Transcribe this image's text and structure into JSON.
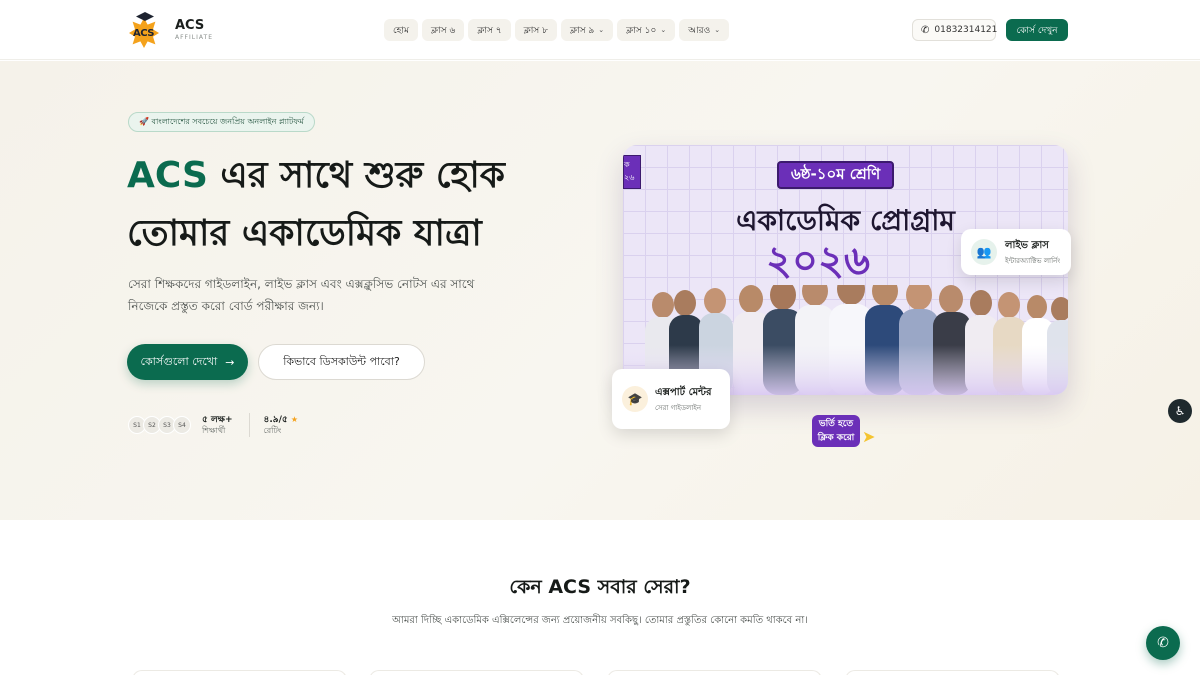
{
  "header": {
    "logo_title": "ACS",
    "logo_subtitle": "AFFILIATE",
    "logo_mark_text": "ACS",
    "nav": [
      {
        "label": "হোম",
        "has_dropdown": false
      },
      {
        "label": "ক্লাস ৬",
        "has_dropdown": false
      },
      {
        "label": "ক্লাস ৭",
        "has_dropdown": false
      },
      {
        "label": "ক্লাস ৮",
        "has_dropdown": false
      },
      {
        "label": "ক্লাস ৯",
        "has_dropdown": true
      },
      {
        "label": "ক্লাস ১০",
        "has_dropdown": true
      },
      {
        "label": "আরও",
        "has_dropdown": true
      }
    ],
    "phone": "01832314121",
    "cta_label": "কোর্স দেখুন"
  },
  "hero": {
    "badge": "🚀 বাংলাদেশের সবচেয়ে জনপ্রিয় অনলাইন প্ল্যাটফর্ম",
    "title_brand": "ACS",
    "title_rest_line1": " এর সাথে শুরু হোক",
    "title_line2": "তোমার একাডেমিক যাত্রা",
    "subtext": "সেরা শিক্ষকদের গাইডলাইন, লাইভ ক্লাস এবং এক্সক্লুসিভ নোটস এর সাথে নিজেকে প্রস্তুত করো বোর্ড পরীক্ষার জন্য।",
    "primary_button": "কোর্সগুলো দেখো",
    "secondary_button": "কিভাবে ডিসকাউন্ট পাবো?",
    "avatars": [
      "S1",
      "S2",
      "S3",
      "S4"
    ],
    "stat_students_value": "৫ লক্ষ+",
    "stat_students_label": "শিক্ষার্থী",
    "stat_rating_value": "৪.৯/৫",
    "stat_rating_label": "রেটিং"
  },
  "banner": {
    "tag": "৬ষ্ঠ-১০ম শ্রেণি",
    "title": "একাডেমিক প্রোগ্রাম",
    "year": "২০২৬",
    "left_strip": "ক ২৬",
    "enroll_tag": "ভর্তি হতে ক্লিক করো"
  },
  "floating": {
    "live_title": "লাইভ ক্লাস",
    "live_sub": "ইন্টারঅ্যাক্টিভ লার্নিং",
    "mentor_title": "এক্সপার্ট মেন্টর",
    "mentor_sub": "সেরা গাইডলাইন"
  },
  "section": {
    "title": "কেন ACS সবার সেরা?",
    "subtitle": "আমরা দিচ্ছি একাডেমিক এক্সিলেন্সের জন্য প্রয়োজনীয় সবকিছু। তোমার প্রস্তুতির কোনো কমতি থাকবে না।"
  },
  "colors": {
    "brand_green": "#0b6b4f",
    "banner_purple": "#6b2fb8",
    "star": "#f4a21c"
  },
  "icons": [
    "phone-icon",
    "arrow-right-icon",
    "star-icon",
    "user-group-icon",
    "graduation-cap-icon",
    "accessibility-icon",
    "chat-icon",
    "chevron-down-icon",
    "rocket-icon"
  ]
}
